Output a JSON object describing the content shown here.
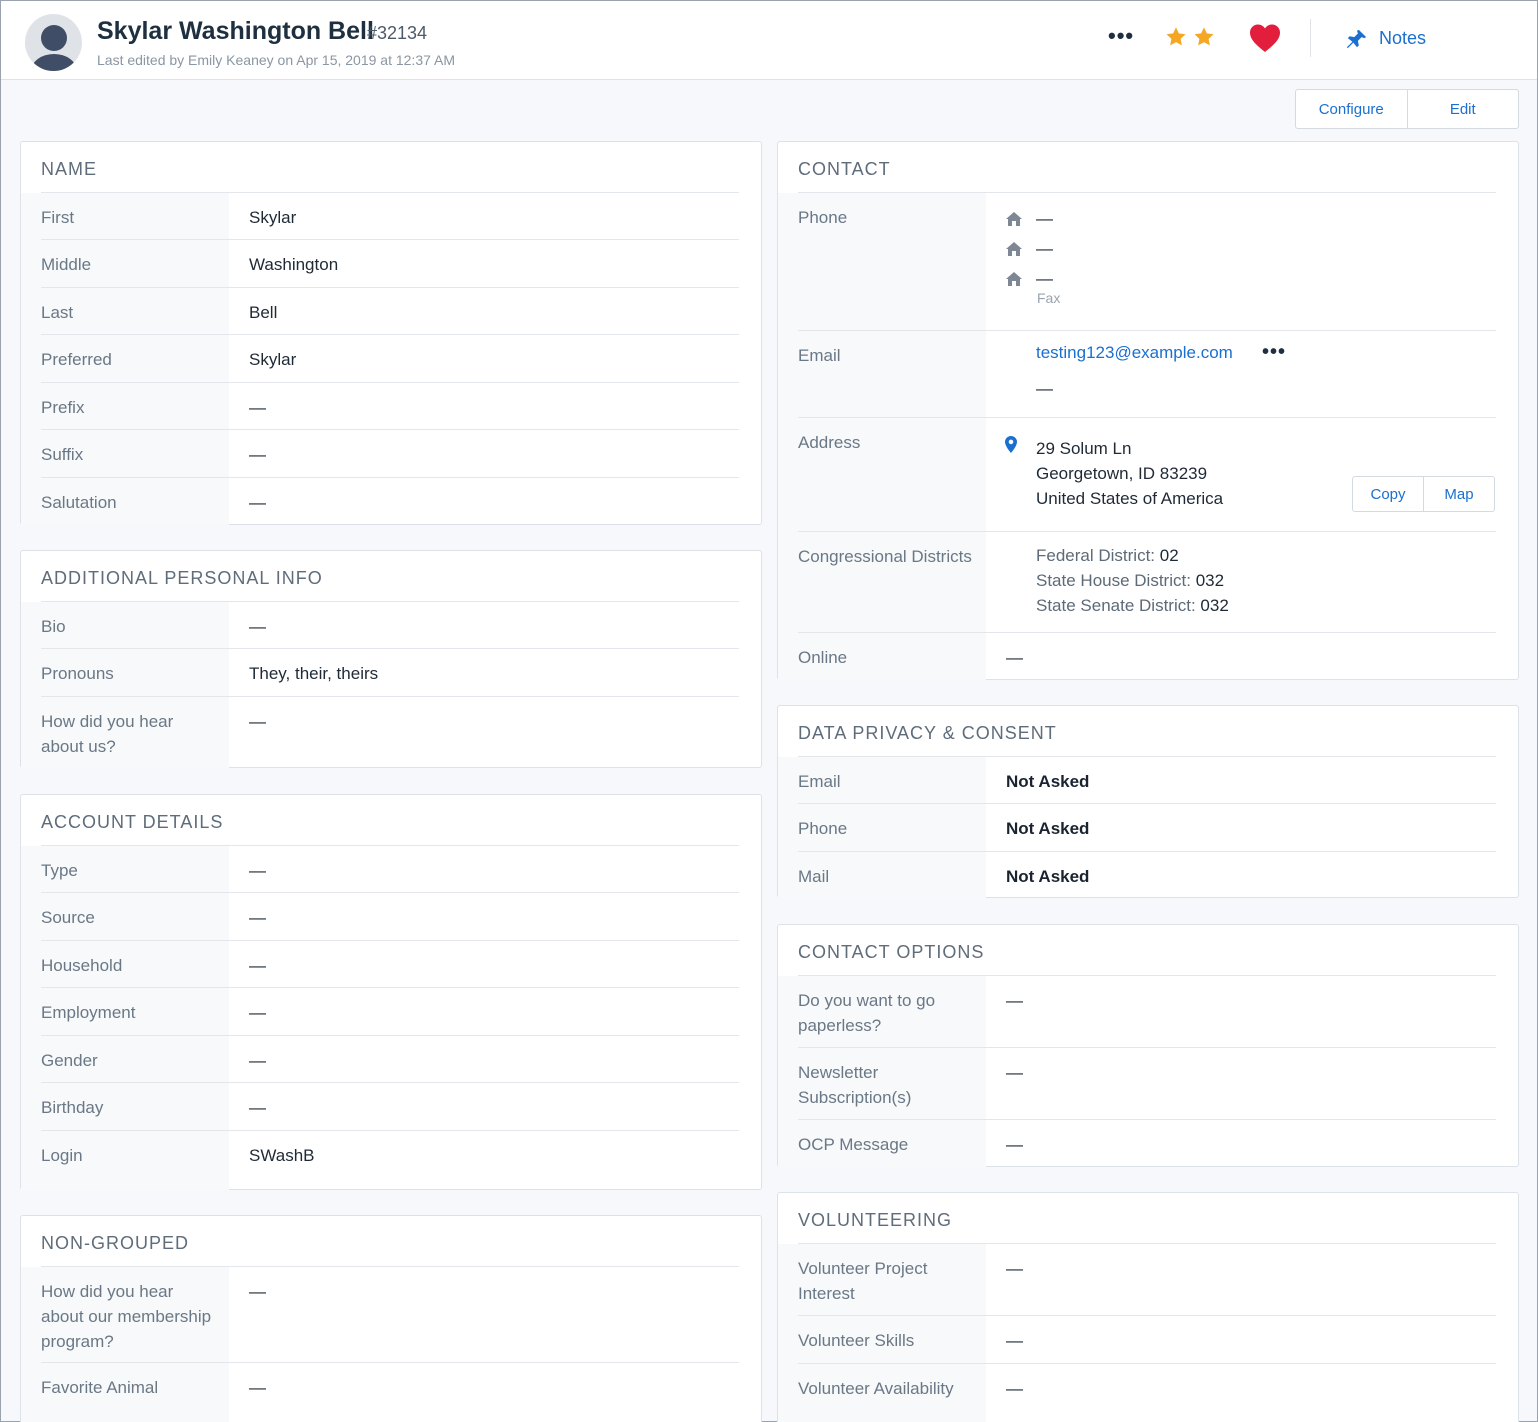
{
  "header": {
    "name": "Skylar Washington Bell",
    "record_id": "#32134",
    "last_edited": "Last edited by Emily Keaney on Apr 15, 2019 at 12:37 AM",
    "more_icon": "more-horizontal-icon",
    "rating_stars": 2,
    "favorite_icon": "heart-icon",
    "favorite_color": "#e31d3c",
    "star_color": "#f5a623",
    "notes_label": "Notes"
  },
  "toolbar": {
    "configure_label": "Configure",
    "edit_label": "Edit"
  },
  "name_section": {
    "title": "NAME",
    "rows": [
      {
        "label": "First",
        "value": "Skylar"
      },
      {
        "label": "Middle",
        "value": "Washington"
      },
      {
        "label": "Last",
        "value": "Bell"
      },
      {
        "label": "Preferred",
        "value": "Skylar"
      },
      {
        "label": "Prefix",
        "value": "—"
      },
      {
        "label": "Suffix",
        "value": "—"
      },
      {
        "label": "Salutation",
        "value": "—"
      }
    ]
  },
  "additional_section": {
    "title": "ADDITIONAL PERSONAL INFO",
    "rows": [
      {
        "label": "Bio",
        "value": "—"
      },
      {
        "label": "Pronouns",
        "value": "They, their, theirs"
      },
      {
        "label": "How did you hear about us?",
        "value": "—"
      }
    ]
  },
  "account_section": {
    "title": "ACCOUNT DETAILS",
    "rows": [
      {
        "label": "Type",
        "value": "—"
      },
      {
        "label": "Source",
        "value": "—"
      },
      {
        "label": "Household",
        "value": "—"
      },
      {
        "label": "Employment",
        "value": "—"
      },
      {
        "label": "Gender",
        "value": "—"
      },
      {
        "label": "Birthday",
        "value": "—"
      },
      {
        "label": "Login",
        "value": "SWashB"
      }
    ]
  },
  "nongrouped_section": {
    "title": "NON-GROUPED",
    "rows": [
      {
        "label": "How did you hear about our membership program?",
        "value": "—"
      },
      {
        "label": "Favorite Animal",
        "value": "—"
      }
    ]
  },
  "contact_section": {
    "title": "CONTACT",
    "phone": {
      "label": "Phone",
      "lines": [
        "—",
        "—",
        "—"
      ],
      "fax_label": "Fax"
    },
    "email": {
      "label": "Email",
      "address": "testing123@example.com",
      "secondary": "—"
    },
    "address": {
      "label": "Address",
      "line1": "29 Solum Ln",
      "line2": "Georgetown, ID 83239",
      "line3": "United States of America",
      "copy_label": "Copy",
      "map_label": "Map"
    },
    "districts": {
      "label": "Congressional Districts",
      "federal_label": "Federal District:",
      "federal_value": "02",
      "house_label": "State House District:",
      "house_value": "032",
      "senate_label": "State Senate District:",
      "senate_value": "032"
    },
    "online": {
      "label": "Online",
      "value": "—"
    }
  },
  "privacy_section": {
    "title": "DATA PRIVACY & CONSENT",
    "rows": [
      {
        "label": "Email",
        "value": "Not Asked"
      },
      {
        "label": "Phone",
        "value": "Not Asked"
      },
      {
        "label": "Mail",
        "value": "Not Asked"
      }
    ]
  },
  "contact_options_section": {
    "title": "CONTACT OPTIONS",
    "rows": [
      {
        "label": "Do you want to go paperless?",
        "value": "—"
      },
      {
        "label": "Newsletter Subscription(s)",
        "value": "—"
      },
      {
        "label": "OCP Message",
        "value": "—"
      }
    ]
  },
  "volunteering_section": {
    "title": "VOLUNTEERING",
    "rows": [
      {
        "label": "Volunteer Project Interest",
        "value": "—"
      },
      {
        "label": "Volunteer Skills",
        "value": "—"
      },
      {
        "label": "Volunteer Availability",
        "value": "—"
      }
    ]
  }
}
